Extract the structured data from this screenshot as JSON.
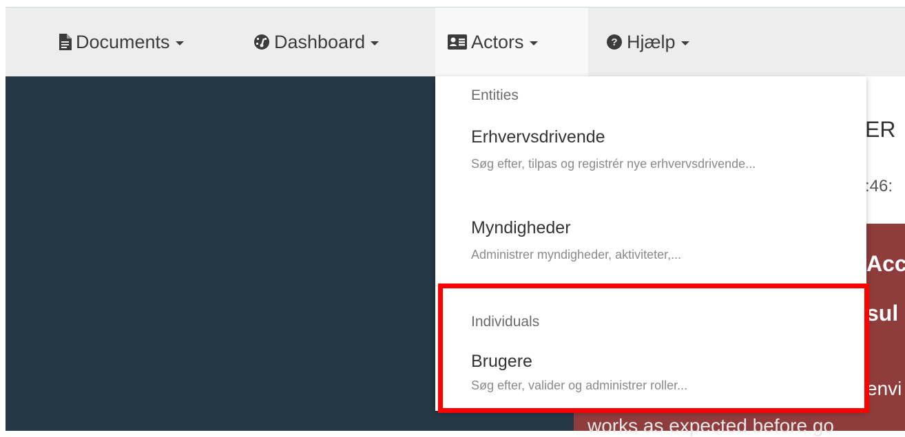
{
  "navbar": {
    "items": [
      {
        "label": "Documents",
        "icon": "file-icon"
      },
      {
        "label": "Dashboard",
        "icon": "dashboard-icon"
      },
      {
        "label": "Actors",
        "icon": "id-card-icon",
        "active": true
      },
      {
        "label": "Hjælp",
        "icon": "help-icon"
      }
    ]
  },
  "dropdown": {
    "sections": [
      {
        "header": "Entities",
        "items": [
          {
            "title": "Erhvervsdrivende",
            "description": "Søg efter, tilpas og registrér nye erhvervsdrivende..."
          },
          {
            "title": "Myndigheder",
            "description": "Administrer myndigheder, aktiviteter,..."
          }
        ]
      },
      {
        "header": "Individuals",
        "items": [
          {
            "title": "Brugere",
            "description": "Søg efter, valider og administrer roller..."
          }
        ]
      }
    ]
  },
  "background": {
    "fragment_er": "ER",
    "fragment_time": ":46:",
    "alert_line1": "Acc",
    "alert_line2": "sul",
    "alert_line3": "envi",
    "alert_line4": "works as expected before go"
  },
  "colors": {
    "navbar_bg": "#ededed",
    "content_bg": "#253846",
    "alert_bg": "#8e3c3c",
    "highlight": "#ff0000"
  }
}
